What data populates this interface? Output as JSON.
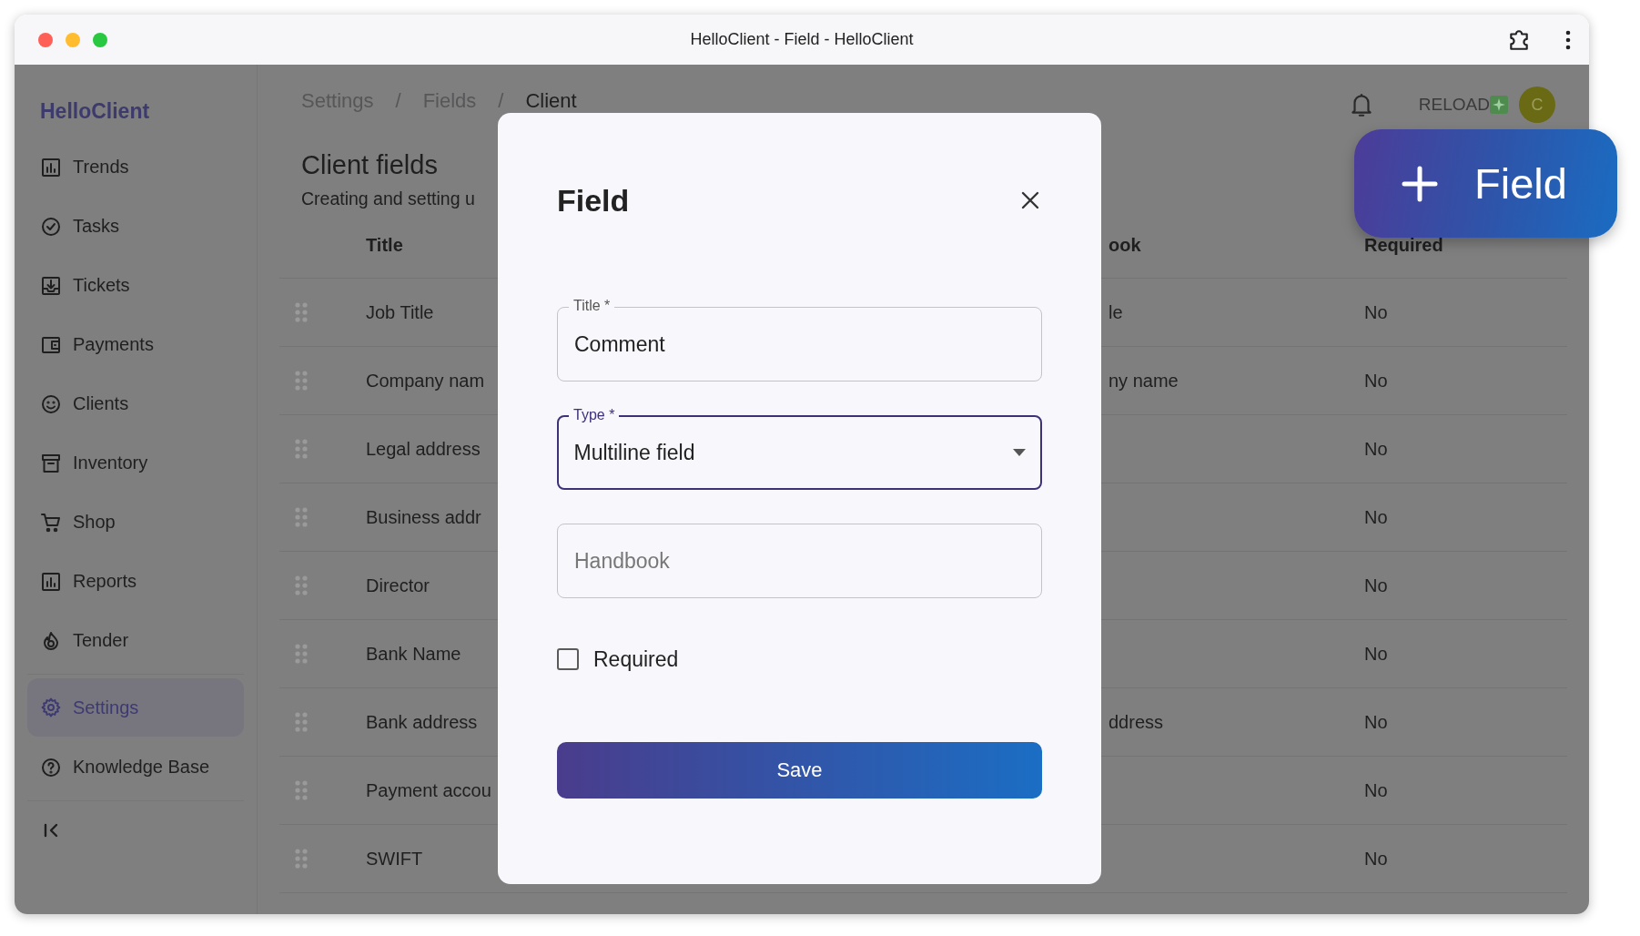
{
  "window": {
    "title": "HelloClient - Field - HelloClient"
  },
  "sidebar": {
    "brand": "HelloClient",
    "groups": [
      {
        "items": [
          {
            "label": "Trends",
            "selected": false
          },
          {
            "label": "Tasks",
            "selected": false
          },
          {
            "label": "Tickets",
            "selected": false
          },
          {
            "label": "Payments",
            "selected": false
          },
          {
            "label": "Clients",
            "selected": false
          },
          {
            "label": "Inventory",
            "selected": false
          },
          {
            "label": "Shop",
            "selected": false
          },
          {
            "label": "Reports",
            "selected": false
          },
          {
            "label": "Tender",
            "selected": false
          }
        ]
      },
      {
        "items": [
          {
            "label": "Settings",
            "selected": true
          },
          {
            "label": "Knowledge Base",
            "selected": false
          }
        ]
      }
    ]
  },
  "header": {
    "breadcrumb": [
      "Settings",
      "Fields",
      "Client"
    ],
    "separator": "/",
    "reload": "RELOAD",
    "avatar": "C"
  },
  "page": {
    "title": "Client fields",
    "subtitle": "Creating and setting u"
  },
  "table": {
    "columns": [
      "Title",
      "ook",
      "Required"
    ],
    "rows": [
      {
        "title": "Job Title",
        "handbook": "le",
        "required": "No"
      },
      {
        "title": "Company nam",
        "handbook": "ny name",
        "required": "No"
      },
      {
        "title": "Legal address",
        "required": "No"
      },
      {
        "title": "Business addr",
        "required": "No"
      },
      {
        "title": "Director",
        "required": "No"
      },
      {
        "title": "Bank Name",
        "required": "No"
      },
      {
        "title": "Bank address",
        "handbook": "ddress",
        "required": "No"
      },
      {
        "title": "Payment accou",
        "required": "No"
      },
      {
        "title": "SWIFT",
        "required": "No"
      }
    ]
  },
  "dialog": {
    "title": "Field",
    "fields": [
      {
        "kind": "text",
        "label": "Title *",
        "value": "Comment",
        "focused": false
      },
      {
        "kind": "select",
        "label": "Type *",
        "value": "Multiline field",
        "focused": true
      },
      {
        "kind": "text",
        "placeholder": "Handbook",
        "focused": false
      }
    ],
    "checkbox": {
      "label": "Required",
      "checked": false
    },
    "save": "Save"
  },
  "fab": {
    "label": "Field"
  }
}
